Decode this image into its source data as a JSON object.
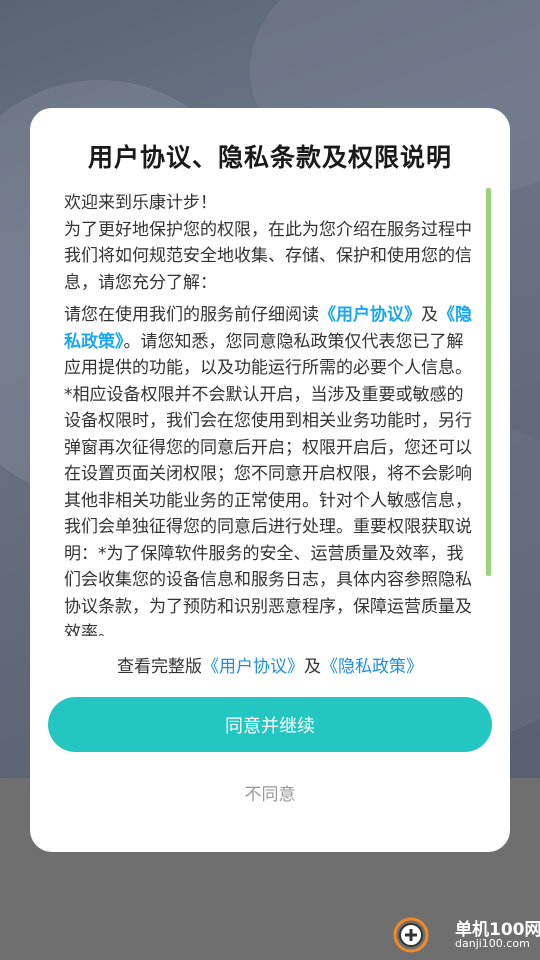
{
  "dialog": {
    "title": "用户协议、隐私条款及权限说明",
    "content": {
      "welcome": "欢迎来到乐康计步！",
      "intro": "为了更好地保护您的权限，在此为您介绍在服务过程中我们将如何规范安全地收集、存储、保护和使用您的信息，请您充分了解：",
      "read_prefix": "请您在使用我们的服务前仔细阅读",
      "user_agreement_link": "《用户协议》",
      "and_text": "及",
      "privacy_policy_link": "《隐私政策》",
      "read_suffix": "。请您知悉，您同意隐私政策仅代表您已了解应用提供的功能，以及功能运行所需的必要个人信息。",
      "permission_text": "*相应设备权限并不会默认开启，当涉及重要或敏感的设备权限时，我们会在您使用到相关业务功能时，另行弹窗再次征得您的同意后开启；权限开启后，您还可以在设置页面关闭权限；您不同意开启权限，将不会影响其他非相关功能业务的正常使用。针对个人敏感信息，我们会单独征得您的同意后进行处理。重要权限获取说明：*为了保障软件服务的安全、运营质量及效率，我们会收集您的设备信息和服务日志，具体内容参照隐私协议条款，为了预防和识别恶意程序，保障运营质量及效率。"
    },
    "footer": {
      "prefix": "查看完整版",
      "user_agreement_link": "《用户协议》",
      "and_text": "及",
      "privacy_policy_link": "《隐私政策》"
    },
    "agree_button": "同意并继续",
    "disagree_button": "不同意"
  },
  "watermark": {
    "name_cn": "单机100网",
    "domain": "danji100.com"
  },
  "colors": {
    "accent": "#23c6c1",
    "link": "#1aa6f0",
    "scrollbar": "#9ad37a"
  }
}
